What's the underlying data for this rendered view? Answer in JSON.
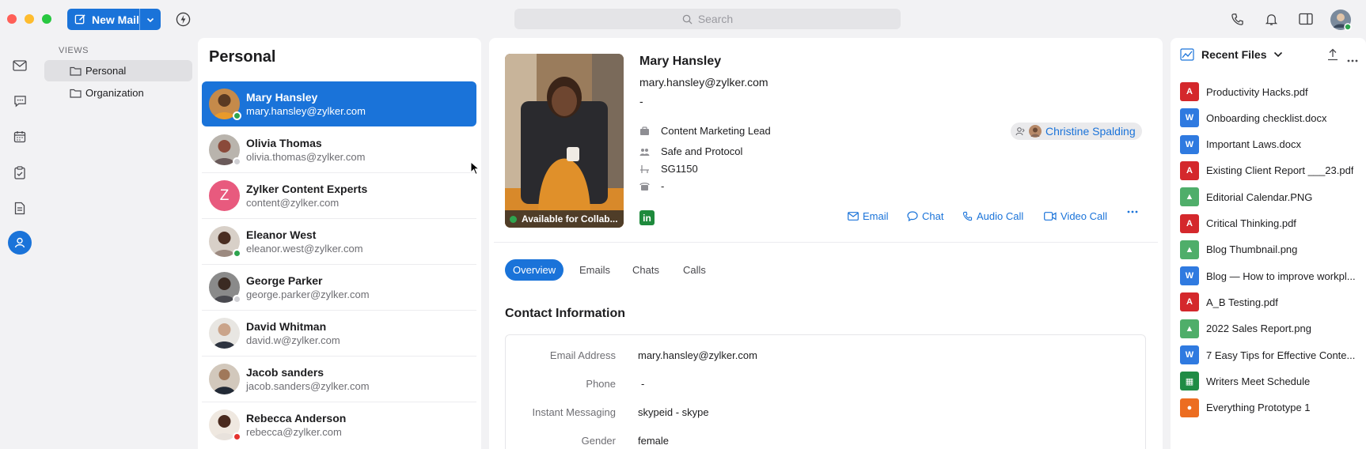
{
  "toolbar": {
    "new_mail_label": "New Mail",
    "search_placeholder": "Search"
  },
  "views": {
    "heading": "VIEWS",
    "items": [
      {
        "label": "Personal",
        "active": true
      },
      {
        "label": "Organization",
        "active": false
      }
    ]
  },
  "contact_list": {
    "title": "Personal",
    "contacts": [
      {
        "name": "Mary Hansley",
        "email": "mary.hansley@zylker.com",
        "selected": true,
        "status": "online"
      },
      {
        "name": "Olivia Thomas",
        "email": "olivia.thomas@zylker.com",
        "selected": false,
        "status": "offline"
      },
      {
        "name": "Zylker Content Experts",
        "email": "content@zylker.com",
        "selected": false,
        "status": "none",
        "initial": "Z"
      },
      {
        "name": "Eleanor West",
        "email": "eleanor.west@zylker.com",
        "selected": false,
        "status": "online"
      },
      {
        "name": "George Parker",
        "email": "george.parker@zylker.com",
        "selected": false,
        "status": "offline"
      },
      {
        "name": "David Whitman",
        "email": "david.w@zylker.com",
        "selected": false,
        "status": "none"
      },
      {
        "name": "Jacob sanders",
        "email": "jacob.sanders@zylker.com",
        "selected": false,
        "status": "none"
      },
      {
        "name": "Rebecca Anderson",
        "email": "rebecca@zylker.com",
        "selected": false,
        "status": "busy"
      }
    ]
  },
  "detail": {
    "name": "Mary Hansley",
    "email": "mary.hansley@zylker.com",
    "secondary": "-",
    "status_badge": "Available for Collab...",
    "designation": "Content Marketing Lead",
    "department": "Safe and Protocol",
    "seat": "SG1150",
    "extension": "-",
    "manager": "Christine Spalding",
    "linkedin": "in",
    "actions": {
      "email": "Email",
      "chat": "Chat",
      "audio": "Audio Call",
      "video": "Video Call"
    },
    "tabs": [
      "Overview",
      "Emails",
      "Chats",
      "Calls"
    ],
    "contact_info": {
      "title": "Contact Information",
      "fields": [
        {
          "label": "Email Address",
          "value": "mary.hansley@zylker.com"
        },
        {
          "label": "Phone",
          "value": "-"
        },
        {
          "label": "Instant Messaging",
          "value": "skypeid - skype"
        },
        {
          "label": "Gender",
          "value": "female"
        }
      ]
    }
  },
  "recent_files": {
    "title": "Recent Files",
    "files": [
      {
        "name": "Productivity Hacks.pdf",
        "type": "pdf"
      },
      {
        "name": "Onboarding checklist.docx",
        "type": "doc"
      },
      {
        "name": "Important Laws.docx",
        "type": "doc"
      },
      {
        "name": "Existing Client Report ___23.pdf",
        "type": "pdf"
      },
      {
        "name": "Editorial Calendar.PNG",
        "type": "img"
      },
      {
        "name": "Critical Thinking.pdf",
        "type": "pdf"
      },
      {
        "name": "Blog Thumbnail.png",
        "type": "img"
      },
      {
        "name": "Blog — How to improve workpl...",
        "type": "doc"
      },
      {
        "name": "A_B Testing.pdf",
        "type": "pdf"
      },
      {
        "name": "2022 Sales Report.png",
        "type": "img"
      },
      {
        "name": "7 Easy Tips for Effective Conte...",
        "type": "doc"
      },
      {
        "name": "Writers Meet Schedule",
        "type": "sheet"
      },
      {
        "name": "Everything Prototype 1",
        "type": "slides"
      }
    ]
  },
  "colors": {
    "accent": "#1a73d9",
    "online": "#2ea44f",
    "busy": "#e5322d",
    "pdf": "#d4282c",
    "doc": "#2f7ae0",
    "img": "#4fae6a",
    "sheet": "#1f8c45",
    "slides": "#ec6d21"
  }
}
